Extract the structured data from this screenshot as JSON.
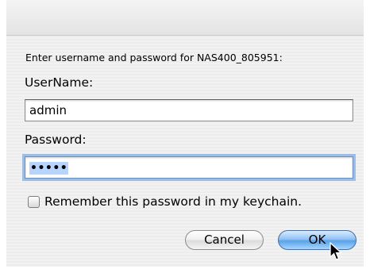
{
  "dialog": {
    "prompt": "Enter username and password for NAS400_805951:",
    "username_label": "UserName:",
    "username_value": "admin",
    "password_label": "Password:",
    "password_value": "•••••",
    "remember_label": "Remember this password in my keychain.",
    "remember_checked": false,
    "cancel_label": "Cancel",
    "ok_label": "OK"
  },
  "colors": {
    "background": "#ececec",
    "focus_ring": "#9cbde6",
    "selection": "#b5d5ff",
    "default_button": "#5aa2e8"
  },
  "icons": {
    "pointer": "mouse-pointer-icon"
  }
}
